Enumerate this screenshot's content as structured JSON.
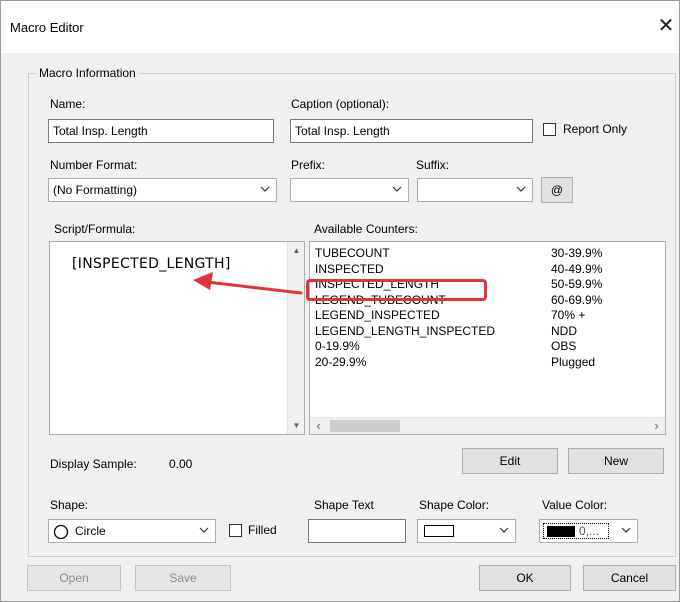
{
  "window": {
    "title": "Macro Editor",
    "close_glyph": "✕"
  },
  "group": {
    "title": "Macro Information"
  },
  "name": {
    "label": "Name:",
    "value": "Total Insp. Length"
  },
  "caption": {
    "label": "Caption (optional):",
    "value": "Total Insp. Length"
  },
  "report_only": {
    "label": "Report Only",
    "checked": false
  },
  "number_format": {
    "label": "Number Format:",
    "value": "(No Formatting)"
  },
  "prefix": {
    "label": "Prefix:",
    "value": ""
  },
  "suffix": {
    "label": "Suffix:",
    "value": ""
  },
  "at_button": {
    "label": "@"
  },
  "script": {
    "label": "Script/Formula:",
    "text": "[INSPECTED_LENGTH]"
  },
  "counters": {
    "label": "Available Counters:",
    "col1": [
      "TUBECOUNT",
      "INSPECTED",
      "INSPECTED_LENGTH",
      "LEGEND_TUBECOUNT",
      "LEGEND_INSPECTED",
      "LEGEND_LENGTH_INSPECTED",
      "0-19.9%",
      "20-29.9%"
    ],
    "col2": [
      "30-39.9%",
      "40-49.9%",
      "50-59.9%",
      "60-69.9%",
      "70% +",
      "NDD",
      "OBS",
      "Plugged"
    ],
    "highlighted": "INSPECTED_LENGTH"
  },
  "display_sample": {
    "label": "Display Sample:",
    "value": "0.00"
  },
  "edit_button": {
    "label": "Edit"
  },
  "new_button": {
    "label": "New"
  },
  "shape": {
    "label": "Shape:",
    "value": "Circle"
  },
  "filled": {
    "label": "Filled",
    "checked": false
  },
  "shape_text": {
    "label": "Shape Text",
    "value": ""
  },
  "shape_color": {
    "label": "Shape Color:",
    "color": "#ffffff"
  },
  "value_color": {
    "label": "Value Color:",
    "value": "0,...",
    "color": "#000000"
  },
  "buttons": {
    "open": "Open",
    "save": "Save",
    "ok": "OK",
    "cancel": "Cancel"
  },
  "colors": {
    "highlight": "#e0343a",
    "background": "#f0f0f0"
  }
}
